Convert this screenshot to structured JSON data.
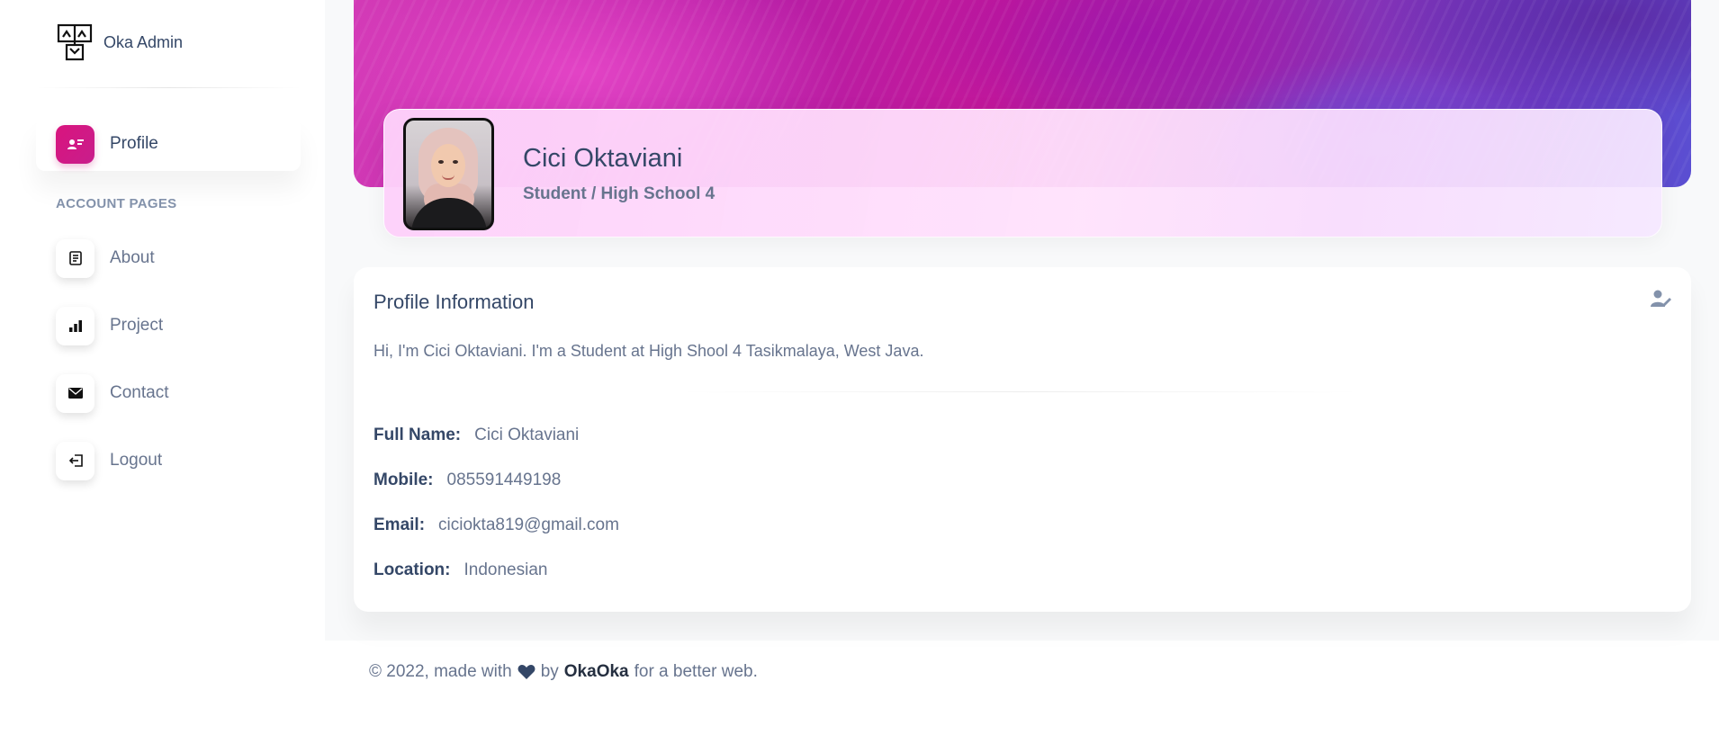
{
  "brand": {
    "name": "Oka Admin",
    "logo_icon": "sitemap-icon"
  },
  "sidebar": {
    "items": [
      {
        "label": "Profile",
        "icon": "profile-icon",
        "active": true
      },
      {
        "label": "About",
        "icon": "document-icon",
        "active": false
      },
      {
        "label": "Project",
        "icon": "bar-chart-icon",
        "active": false
      },
      {
        "label": "Contact",
        "icon": "envelope-icon",
        "active": false
      },
      {
        "label": "Logout",
        "icon": "logout-icon",
        "active": false
      }
    ],
    "section_heading": "ACCOUNT PAGES"
  },
  "profile_header": {
    "name": "Cici Oktaviani",
    "role": "Student / High School 4"
  },
  "profile_info": {
    "title": "Profile Information",
    "description": "Hi, I'm Cici Oktaviani. I'm a Student at High Shool 4 Tasikmalaya, West Java.",
    "fields": [
      {
        "label": "Full Name:",
        "value": "Cici Oktaviani"
      },
      {
        "label": "Mobile:",
        "value": "085591449198"
      },
      {
        "label": "Email:",
        "value": "ciciokta819@gmail.com"
      },
      {
        "label": "Location:",
        "value": "Indonesian"
      }
    ],
    "edit_icon": "user-edit-icon"
  },
  "footer": {
    "prefix": "© 2022, made with",
    "by": "by",
    "author": "OkaOka",
    "suffix": "for a better web."
  },
  "colors": {
    "accent": "#cb0c9f",
    "text_dark": "#344767",
    "text_muted": "#67748e"
  }
}
